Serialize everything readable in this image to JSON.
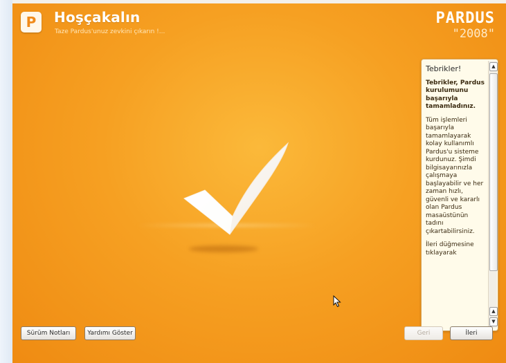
{
  "header": {
    "logo_letter": "P",
    "title": "Hoşçakalın",
    "subtitle": "Taze Pardus'unuz zevkini çıkarın !...",
    "brand_name": "PARDUS",
    "brand_year": "\"2008\""
  },
  "side_panel": {
    "heading": "Tebrikler!",
    "bold_text": "Tebrikler, Pardus kurulumunu başarıyla tamamladınız.",
    "body_text": "Tüm işlemleri başarıyla tamamlayarak kolay kullanımlı Pardus'u sisteme kurdunuz. Şimdi bilgisayarınızla çalışmaya başlayabilir ve her zaman hızlı, güvenli ve kararlı olan Pardus masaüstünün tadını çıkartabilirsiniz.",
    "cut_text": "İleri düğmesine tıklayarak"
  },
  "buttons": {
    "release_notes": "Sürüm Notları",
    "show_help": "Yardımı Göster",
    "back": "Geri",
    "next": "İleri"
  },
  "colors": {
    "background_center": "#fbb93a",
    "background_edge": "#ef8b12",
    "panel_bg": "#fffbea"
  },
  "icons": {
    "logo": "pardus-logo-icon",
    "center": "checkmark-icon",
    "cursor": "mouse-pointer-icon"
  }
}
